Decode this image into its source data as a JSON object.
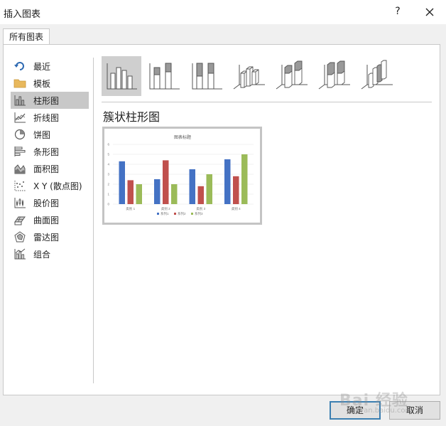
{
  "window": {
    "title": "插入图表",
    "help_label": "?"
  },
  "tabs": [
    {
      "label": "所有图表"
    }
  ],
  "sidebar": {
    "items": [
      {
        "label": "最近",
        "icon": "recent-icon"
      },
      {
        "label": "模板",
        "icon": "folder-icon"
      },
      {
        "label": "柱形图",
        "icon": "column-chart-icon",
        "selected": true
      },
      {
        "label": "折线图",
        "icon": "line-chart-icon"
      },
      {
        "label": "饼图",
        "icon": "pie-chart-icon"
      },
      {
        "label": "条形图",
        "icon": "bar-chart-icon"
      },
      {
        "label": "面积图",
        "icon": "area-chart-icon"
      },
      {
        "label": "X Y (散点图)",
        "icon": "scatter-chart-icon"
      },
      {
        "label": "股价图",
        "icon": "stock-chart-icon"
      },
      {
        "label": "曲面图",
        "icon": "surface-chart-icon"
      },
      {
        "label": "雷达图",
        "icon": "radar-chart-icon"
      },
      {
        "label": "组合",
        "icon": "combo-chart-icon"
      }
    ]
  },
  "subtypes": [
    {
      "icon": "clustered-column-icon",
      "selected": true
    },
    {
      "icon": "stacked-column-icon"
    },
    {
      "icon": "percent-stacked-column-icon"
    },
    {
      "icon": "3d-clustered-column-icon"
    },
    {
      "icon": "3d-stacked-column-icon"
    },
    {
      "icon": "3d-percent-stacked-column-icon"
    },
    {
      "icon": "3d-column-icon"
    }
  ],
  "selected_subtype_title": "簇状柱形图",
  "chart_data": {
    "type": "bar",
    "title": "图表标题",
    "categories": [
      "类别 1",
      "类别 2",
      "类别 3",
      "类别 4"
    ],
    "series": [
      {
        "name": "系列1",
        "values": [
          4.3,
          2.5,
          3.5,
          4.5
        ],
        "color": "#4472c4"
      },
      {
        "name": "系列2",
        "values": [
          2.4,
          4.4,
          1.8,
          2.8
        ],
        "color": "#c0504d"
      },
      {
        "name": "系列3",
        "values": [
          2.0,
          2.0,
          3.0,
          5.0
        ],
        "color": "#9bbb59"
      }
    ],
    "ylim": [
      0,
      6
    ],
    "yticks": [
      "0",
      "1",
      "2",
      "3",
      "4",
      "5",
      "6"
    ],
    "grid": true,
    "legend": "bottom"
  },
  "buttons": {
    "ok": "确定",
    "cancel": "取消"
  },
  "watermark": {
    "text": "Bai 经验",
    "sub": "jingyan.baidu.com"
  }
}
